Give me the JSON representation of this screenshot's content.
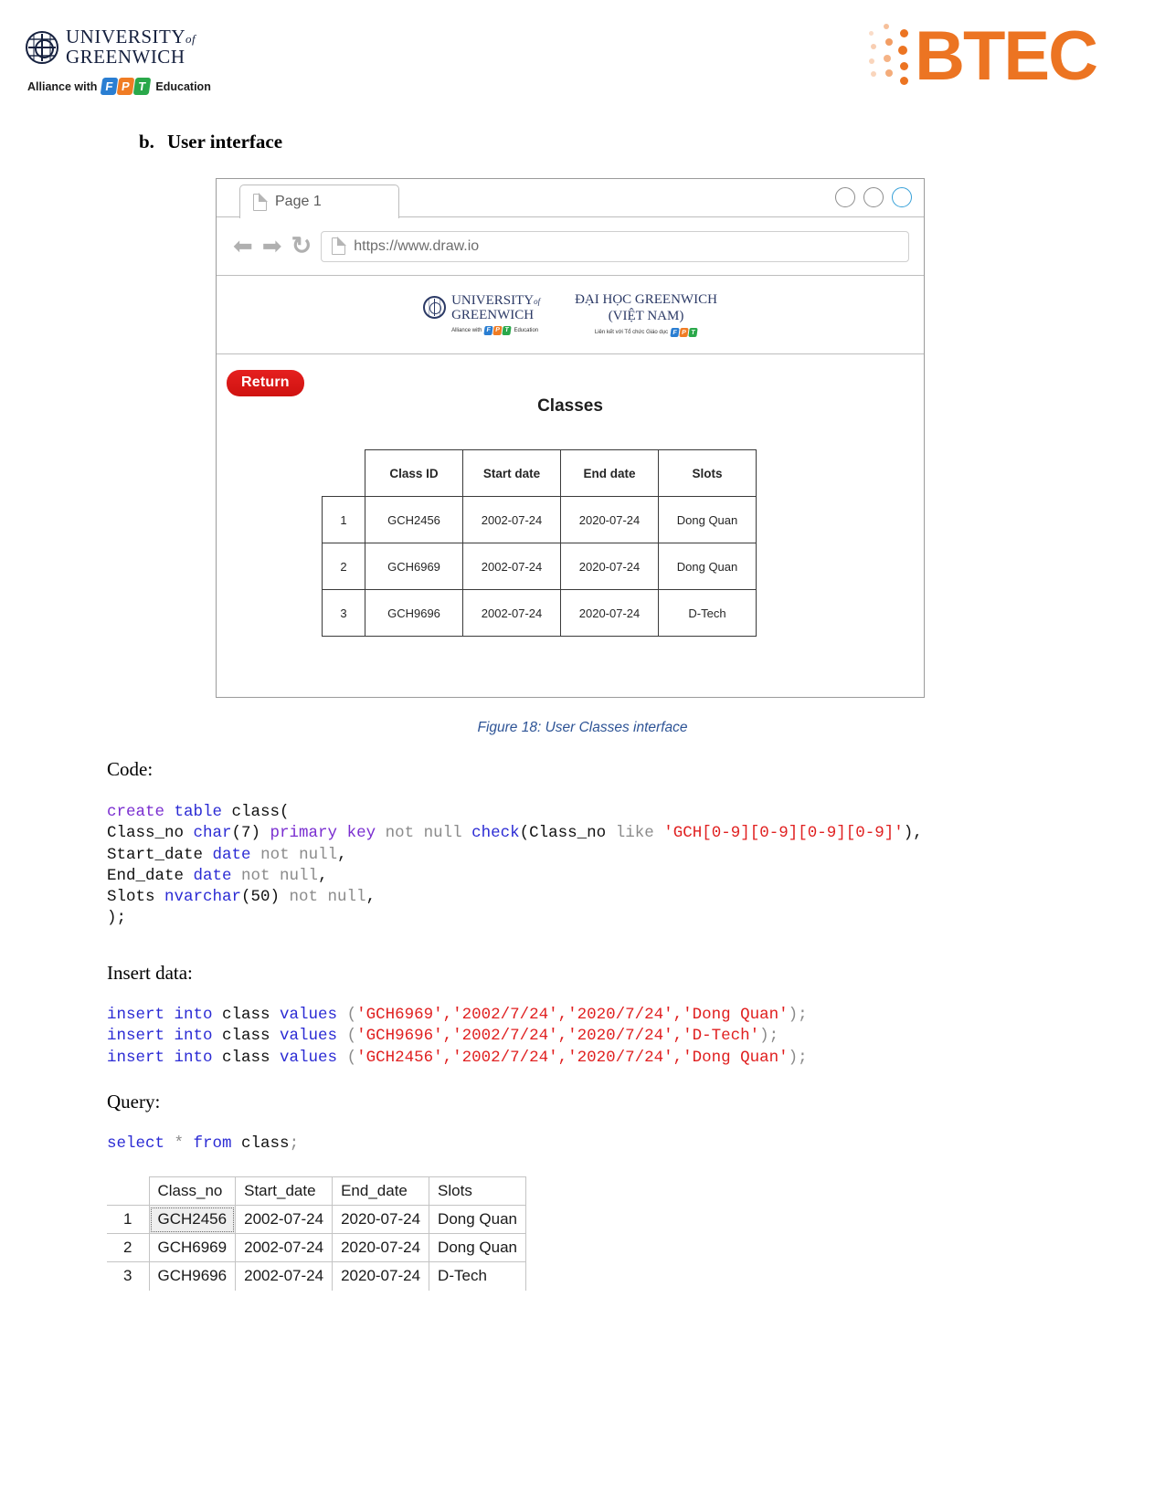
{
  "header": {
    "university": {
      "line1_main": "UNIVERSITY",
      "line1_of": "of",
      "line2": "GREENWICH",
      "alliance_prefix": "Alliance with",
      "fpt_letters": [
        "F",
        "P",
        "T"
      ],
      "alliance_suffix": "Education"
    },
    "btec": {
      "text": "BTEC",
      "color": "#ec7422"
    }
  },
  "section": {
    "marker": "b.",
    "title": "User interface"
  },
  "browser": {
    "tab_label": "Page 1",
    "tab_icon": "document-icon",
    "url": "https://www.draw.io",
    "url_icon": "document-icon",
    "back_icon": "⬅",
    "forward_icon": "➡",
    "reload_icon": "↻",
    "window_controls": [
      "minimize",
      "maximize",
      "close"
    ],
    "active_control_color": "#36a0d8"
  },
  "embedded_page": {
    "banner": {
      "uog_line1_main": "UNIVERSITY",
      "uog_line1_of": "of",
      "uog_line2": "GREENWICH",
      "alliance_prefix": "Alliance with",
      "alliance_suffix": "Education",
      "vn_line1": "ĐẠI HỌC GREENWICH",
      "vn_line2": "(VIỆT NAM)",
      "vn_sub": "Liên kết với Tổ chức Giáo dục"
    },
    "return_button": "Return",
    "page_title": "Classes",
    "table": {
      "columns": [
        "Class ID",
        "Start date",
        "End date",
        "Slots"
      ],
      "rows": [
        {
          "n": "1",
          "class_id": "GCH2456",
          "start_date": "2002-07-24",
          "end_date": "2020-07-24",
          "slots": "Dong Quan"
        },
        {
          "n": "2",
          "class_id": "GCH6969",
          "start_date": "2002-07-24",
          "end_date": "2020-07-24",
          "slots": "Dong Quan"
        },
        {
          "n": "3",
          "class_id": "GCH9696",
          "start_date": "2002-07-24",
          "end_date": "2020-07-24",
          "slots": "D-Tech"
        }
      ]
    }
  },
  "figure_caption": "Figure 18: User Classes interface",
  "labels": {
    "code": "Code:",
    "insert": "Insert data:",
    "query": "Query:"
  },
  "code": {
    "create_table": [
      {
        "t": "create",
        "c": "kw2"
      },
      {
        "t": " ",
        "c": "pun"
      },
      {
        "t": "table",
        "c": "kw"
      },
      {
        "t": " class(\n",
        "c": "pun"
      },
      {
        "t": "Class_no ",
        "c": "pun"
      },
      {
        "t": "char",
        "c": "typ"
      },
      {
        "t": "(7) ",
        "c": "pun"
      },
      {
        "t": "primary",
        "c": "kw2"
      },
      {
        "t": " ",
        "c": "pun"
      },
      {
        "t": "key",
        "c": "kw2"
      },
      {
        "t": " ",
        "c": "pun"
      },
      {
        "t": "not null",
        "c": "dim"
      },
      {
        "t": " ",
        "c": "pun"
      },
      {
        "t": "check",
        "c": "kw"
      },
      {
        "t": "(Class_no ",
        "c": "pun"
      },
      {
        "t": "like",
        "c": "dim"
      },
      {
        "t": " ",
        "c": "pun"
      },
      {
        "t": "'GCH[0-9][0-9][0-9][0-9]'",
        "c": "str"
      },
      {
        "t": "),\n",
        "c": "pun"
      },
      {
        "t": "Start_date ",
        "c": "pun"
      },
      {
        "t": "date",
        "c": "typ"
      },
      {
        "t": " ",
        "c": "pun"
      },
      {
        "t": "not null",
        "c": "dim"
      },
      {
        "t": ",\n",
        "c": "pun"
      },
      {
        "t": "End_date ",
        "c": "pun"
      },
      {
        "t": "date",
        "c": "typ"
      },
      {
        "t": " ",
        "c": "pun"
      },
      {
        "t": "not null",
        "c": "dim"
      },
      {
        "t": ",\n",
        "c": "pun"
      },
      {
        "t": "Slots ",
        "c": "pun"
      },
      {
        "t": "nvarchar",
        "c": "typ"
      },
      {
        "t": "(50) ",
        "c": "pun"
      },
      {
        "t": "not null",
        "c": "dim"
      },
      {
        "t": ",\n",
        "c": "pun"
      },
      {
        "t": ");",
        "c": "pun"
      }
    ],
    "insert_data": [
      {
        "t": "insert into",
        "c": "kw"
      },
      {
        "t": " class ",
        "c": "pun"
      },
      {
        "t": "values",
        "c": "kw"
      },
      {
        "t": " (",
        "c": "dim"
      },
      {
        "t": "'GCH6969','2002/7/24','2020/7/24','Dong Quan'",
        "c": "str"
      },
      {
        "t": ");\n",
        "c": "dim"
      },
      {
        "t": "insert into",
        "c": "kw"
      },
      {
        "t": " class ",
        "c": "pun"
      },
      {
        "t": "values",
        "c": "kw"
      },
      {
        "t": " (",
        "c": "dim"
      },
      {
        "t": "'GCH9696','2002/7/24','2020/7/24','D-Tech'",
        "c": "str"
      },
      {
        "t": ");\n",
        "c": "dim"
      },
      {
        "t": "insert into",
        "c": "kw"
      },
      {
        "t": " class ",
        "c": "pun"
      },
      {
        "t": "values",
        "c": "kw"
      },
      {
        "t": " (",
        "c": "dim"
      },
      {
        "t": "'GCH2456','2002/7/24','2020/7/24','Dong Quan'",
        "c": "str"
      },
      {
        "t": ");",
        "c": "dim"
      }
    ],
    "query": [
      {
        "t": "select",
        "c": "kw"
      },
      {
        "t": " * ",
        "c": "dim"
      },
      {
        "t": "from",
        "c": "kw"
      },
      {
        "t": " class",
        "c": "pun"
      },
      {
        "t": ";",
        "c": "dim"
      }
    ]
  },
  "result_grid": {
    "columns": [
      "Class_no",
      "Start_date",
      "End_date",
      "Slots"
    ],
    "rows": [
      {
        "n": "1",
        "class_no": "GCH2456",
        "start_date": "2002-07-24",
        "end_date": "2020-07-24",
        "slots": "Dong Quan",
        "selected": true
      },
      {
        "n": "2",
        "class_no": "GCH6969",
        "start_date": "2002-07-24",
        "end_date": "2020-07-24",
        "slots": "Dong Quan",
        "selected": false
      },
      {
        "n": "3",
        "class_no": "GCH9696",
        "start_date": "2002-07-24",
        "end_date": "2020-07-24",
        "slots": "D-Tech",
        "selected": false
      }
    ]
  }
}
